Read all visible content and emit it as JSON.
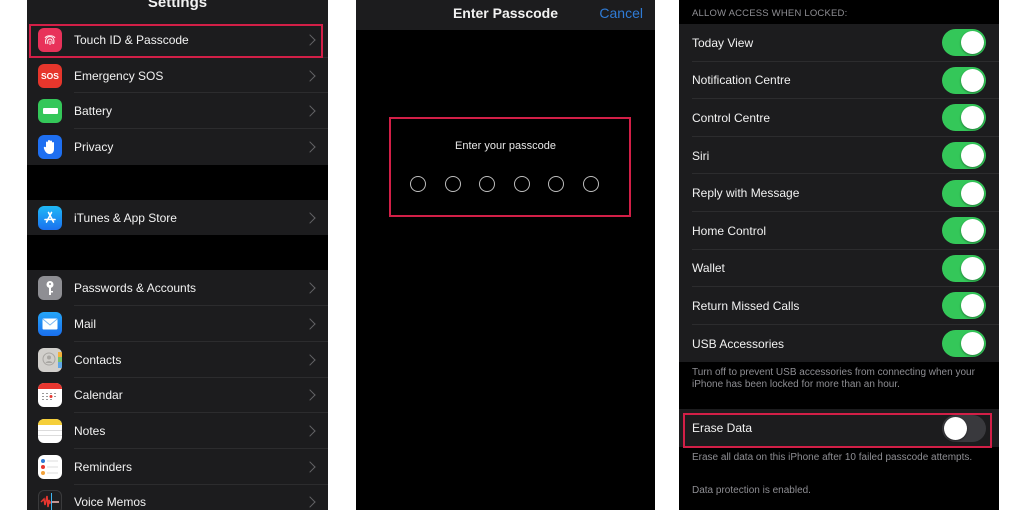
{
  "settings": {
    "title": "Settings",
    "groups": [
      [
        {
          "label": "Touch ID & Passcode",
          "icon": "fingerprint-icon",
          "color": "#e8325a"
        },
        {
          "label": "Emergency SOS",
          "icon": "sos-icon",
          "color": "#e6362c",
          "glyph": "SOS"
        },
        {
          "label": "Battery",
          "icon": "battery-icon",
          "color": "#34c759"
        },
        {
          "label": "Privacy",
          "icon": "hand-icon",
          "color": "#1e6ff1"
        }
      ],
      [
        {
          "label": "iTunes & App Store",
          "icon": "app-store-icon",
          "color": "#1a8cf5"
        }
      ],
      [
        {
          "label": "Passwords & Accounts",
          "icon": "key-icon",
          "color": "#8e8e93"
        },
        {
          "label": "Mail",
          "icon": "mail-icon",
          "color": "#1a8cf5"
        },
        {
          "label": "Contacts",
          "icon": "contacts-icon",
          "color": "#c8c6c2"
        },
        {
          "label": "Calendar",
          "icon": "calendar-icon",
          "color": "#ffffff"
        },
        {
          "label": "Notes",
          "icon": "notes-icon",
          "color": "#ffffff"
        },
        {
          "label": "Reminders",
          "icon": "reminders-icon",
          "color": "#ffffff"
        },
        {
          "label": "Voice Memos",
          "icon": "voice-memos-icon",
          "color": "#1c1c1e"
        }
      ]
    ]
  },
  "passcode": {
    "title": "Enter Passcode",
    "cancel_label": "Cancel",
    "prompt": "Enter your passcode",
    "digits_total": 6,
    "digits_entered": 0
  },
  "access": {
    "section_header": "ALLOW ACCESS WHEN LOCKED:",
    "toggles": [
      {
        "label": "Today View",
        "on": true
      },
      {
        "label": "Notification Centre",
        "on": true
      },
      {
        "label": "Control Centre",
        "on": true
      },
      {
        "label": "Siri",
        "on": true
      },
      {
        "label": "Reply with Message",
        "on": true
      },
      {
        "label": "Home Control",
        "on": true
      },
      {
        "label": "Wallet",
        "on": true
      },
      {
        "label": "Return Missed Calls",
        "on": true
      },
      {
        "label": "USB Accessories",
        "on": true
      }
    ],
    "usb_note": "Turn off to prevent USB accessories from connecting when your iPhone has been locked for more than an hour.",
    "erase": {
      "label": "Erase Data",
      "on": false
    },
    "erase_note": "Erase all data on this iPhone after 10 failed passcode attempts.",
    "protection_note": "Data protection is enabled."
  },
  "colors": {
    "highlight": "#d21f47",
    "toggle_on": "#34c759",
    "link": "#2f7bd6"
  }
}
